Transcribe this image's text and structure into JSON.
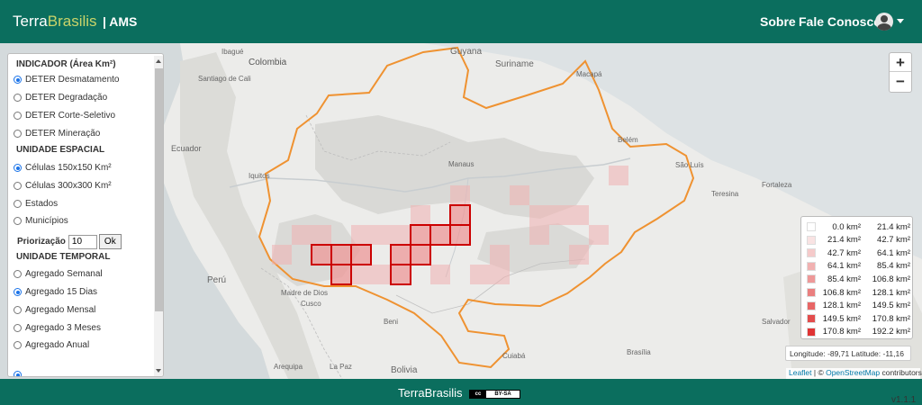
{
  "header": {
    "brand_part1": "Terra",
    "brand_part2": "Brasilis",
    "app_label": "| AMS",
    "nav": {
      "sobre": "Sobre",
      "fale": "Fale Conosco"
    }
  },
  "panel": {
    "indicator_title": "INDICADOR (Área Km²)",
    "indicators": [
      {
        "label": "DETER Desmatamento",
        "selected": true
      },
      {
        "label": "DETER Degradação",
        "selected": false
      },
      {
        "label": "DETER Corte-Seletivo",
        "selected": false
      },
      {
        "label": "DETER Mineração",
        "selected": false
      }
    ],
    "spatial_title": "UNIDADE ESPACIAL",
    "spatial": [
      {
        "label": "Células 150x150 Km²",
        "selected": true
      },
      {
        "label": "Células 300x300 Km²",
        "selected": false
      },
      {
        "label": "Estados",
        "selected": false
      },
      {
        "label": "Municípios",
        "selected": false
      }
    ],
    "priority_label": "Priorização",
    "priority_value": "10",
    "ok_label": "Ok",
    "temporal_title": "UNIDADE TEMPORAL",
    "temporal": [
      {
        "label": "Agregado Semanal",
        "selected": false
      },
      {
        "label": "Agregado 15 Dias",
        "selected": true
      },
      {
        "label": "Agregado Mensal",
        "selected": false
      },
      {
        "label": "Agregado 3 Meses",
        "selected": false
      },
      {
        "label": "Agregado Anual",
        "selected": false
      }
    ]
  },
  "map": {
    "zoom_in": "+",
    "zoom_out": "−",
    "place_labels": [
      "Ibagué",
      "Colombia",
      "Guyana",
      "Suriname",
      "Santiago de Cali",
      "Macapá",
      "Ecuador",
      "Belém",
      "Manaus",
      "São Luís",
      "Teresina",
      "Fortaleza",
      "Iquitos",
      "Perú",
      "Madre de Dios",
      "Cusco",
      "Beni",
      "Arequipa",
      "La Paz",
      "Bolivia",
      "Cuiabá",
      "Brasília",
      "Salvador"
    ],
    "legend": [
      {
        "min": "0.0 km²",
        "max": "21.4 km²",
        "color": "#ffffff"
      },
      {
        "min": "21.4 km²",
        "max": "42.7 km²",
        "color": "#f9e3e3"
      },
      {
        "min": "42.7 km²",
        "max": "64.1 km²",
        "color": "#f5caca"
      },
      {
        "min": "64.1 km²",
        "max": "85.4 km²",
        "color": "#f1b1b1"
      },
      {
        "min": "85.4 km²",
        "max": "106.8 km²",
        "color": "#ee9898"
      },
      {
        "min": "106.8 km²",
        "max": "128.1 km²",
        "color": "#ea7f7f"
      },
      {
        "min": "128.1 km²",
        "max": "149.5 km²",
        "color": "#e76666"
      },
      {
        "min": "149.5 km²",
        "max": "170.8 km²",
        "color": "#e34d4d"
      },
      {
        "min": "170.8 km²",
        "max": "192.2 km²",
        "color": "#e03434"
      }
    ],
    "coords_text": "Longitude: -89,71 Latitude: -11,16",
    "attrib_leaflet": "Leaflet",
    "attrib_sep": " | © ",
    "attrib_osm": "OpenStreetMap",
    "attrib_tail": " contributors"
  },
  "footer": {
    "title": "TerraBrasilis",
    "license_cc": "cc",
    "license_sa": "BY-SA",
    "version": "v1.1.1"
  }
}
